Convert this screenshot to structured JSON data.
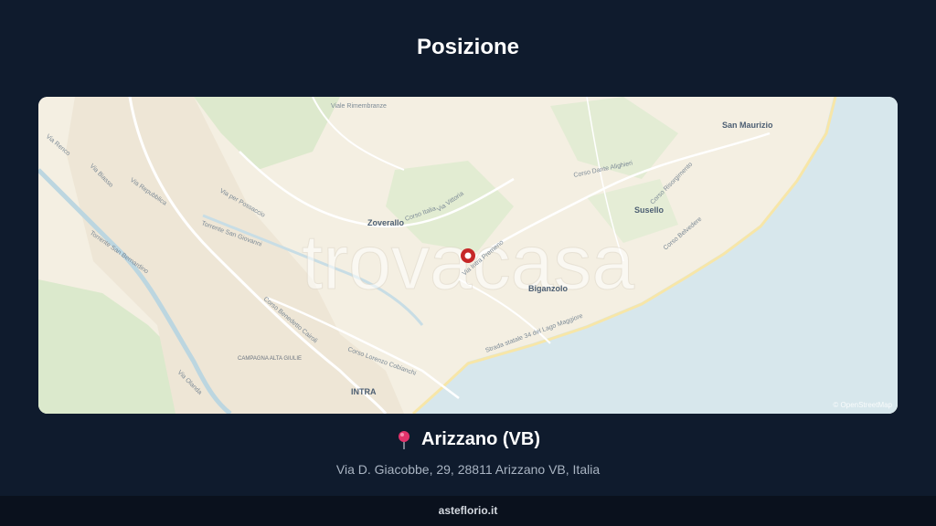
{
  "header": {
    "title": "Posizione"
  },
  "map": {
    "watermark": "trovacasa",
    "attribution": "© OpenStreetMap",
    "places": {
      "san_maurizio": "San Maurizio",
      "susello": "Susello",
      "zoverallo": "Zoverallo",
      "biganzolo": "Biganzolo",
      "intra": "INTRA"
    },
    "roads": {
      "viale_rimembranze": "Viale Rimembranze",
      "via_renco": "Via Renco",
      "via_biasso": "Via Biasso",
      "via_repubblica": "Via Repubblica",
      "via_per_possaccio": "Via per Possaccio",
      "torrente_san_giovanni": "Torrente San Giovanni",
      "corso_italia": "Corso Italia",
      "via_vittoria": "Via Vittoria",
      "via_intra_premeno": "Via Intra Premeno",
      "corso_dante_alighieri": "Corso Dante Alighieri",
      "corso_risorgimento": "Corso Risorgimento",
      "corso_belvedere": "Corso Belvedere",
      "strada_statale": "Strada statale 34 del Lago Maggiore",
      "corso_benedetto_cairoli": "Corso Benedetto Cairoli",
      "corso_lorenzo_cobianchi": "Corso Lorenzo Cobianchi",
      "via_olanda": "Via Olanda",
      "torrente_san_bernardino": "Torrente San Bernardino"
    },
    "districts": {
      "campagna_alta": "CAMPAGNA ALTA GIULIE"
    },
    "marker": {
      "icon": "location-marker-icon",
      "color": "#c62828"
    }
  },
  "location": {
    "icon": "pin-icon",
    "title": "Arizzano (VB)",
    "address": "Via D. Giacobbe, 29, 28811 Arizzano VB, Italia"
  },
  "footer": {
    "brand": "asteflorio.it"
  },
  "colors": {
    "background": "#0f1b2d",
    "footer": "#0a111d",
    "lake": "#d7e7ec",
    "land": "#f4efe2",
    "park": "#d9e8c8",
    "pin": "#e2336b"
  }
}
